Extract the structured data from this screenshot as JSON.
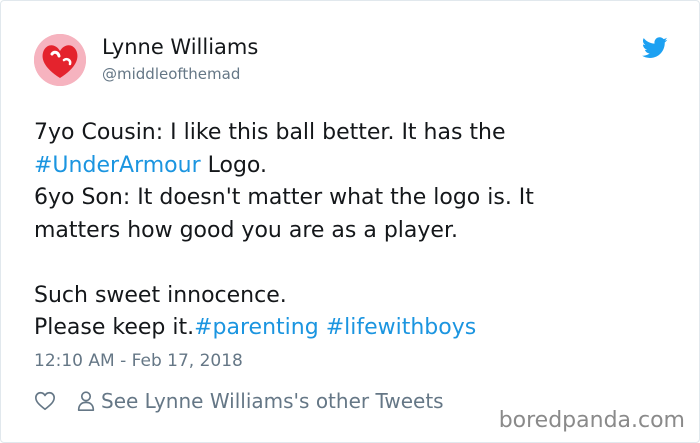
{
  "author": {
    "display_name": "Lynne Williams",
    "handle": "@middleofthemad"
  },
  "icons": {
    "platform": "twitter-bird-icon",
    "avatar": "red-heart-avatar",
    "like": "heart-icon",
    "profile": "person-icon"
  },
  "colors": {
    "link": "#1b95e0",
    "brand": "#1da1f2",
    "muted": "#657786",
    "text": "#14171a"
  },
  "tweet": {
    "line1_pre": "7yo Cousin: I like this ball better. It has the",
    "line2_tag": "#UnderArmour",
    "line2_post": " Logo.",
    "line3": "6yo Son: It doesn't matter what the logo is. It",
    "line4": "matters how good you are as a player.",
    "line6": "Such sweet innocence.",
    "line7_pre": "Please keep it.",
    "tag_parenting": "#parenting",
    "tag_lifewithboys": "#lifewithboys"
  },
  "timestamp": "12:10 AM - Feb 17, 2018",
  "actions": {
    "see_other": "See Lynne Williams's other Tweets"
  },
  "watermark": "boredpanda.com"
}
